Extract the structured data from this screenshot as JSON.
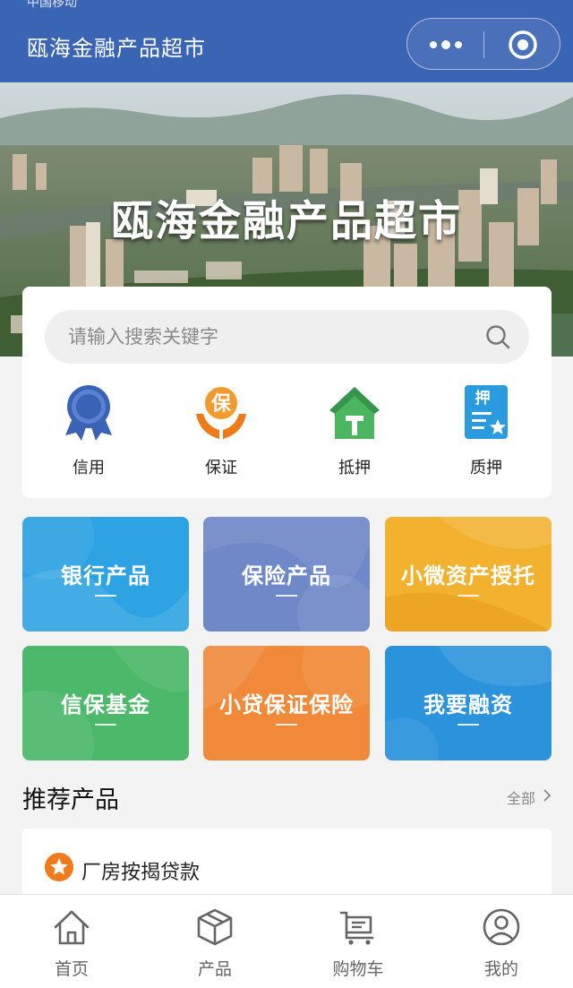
{
  "header": {
    "status_text": "中国移动",
    "title": "瓯海金融产品超市",
    "more_icon": "more-dots-icon",
    "target_icon": "target-icon"
  },
  "banner": {
    "title": "瓯海金融产品超市"
  },
  "search": {
    "placeholder": "请输入搜索关键字",
    "value": ""
  },
  "categories": [
    {
      "label": "信用",
      "icon": "ribbon-medal-icon",
      "color": "#3a62b5"
    },
    {
      "label": "保证",
      "icon": "hands-guarantee-icon",
      "color": "#f07a1c"
    },
    {
      "label": "抵押",
      "icon": "house-icon",
      "color": "#3fae5a"
    },
    {
      "label": "质押",
      "icon": "pledge-document-icon",
      "color": "#2b9be0"
    }
  ],
  "tiles": [
    {
      "label": "银行产品",
      "color": "#2ea3e3"
    },
    {
      "label": "保险产品",
      "color": "#6f88c8"
    },
    {
      "label": "小微资产授托",
      "color": "#f2b12e"
    },
    {
      "label": "信保基金",
      "color": "#4cb86a"
    },
    {
      "label": "小贷保证保险",
      "color": "#f08a3a"
    },
    {
      "label": "我要融资",
      "color": "#2b93dc"
    }
  ],
  "recommend": {
    "title": "推荐产品",
    "more_label": "全部",
    "items": [
      {
        "name": "厂房按揭贷款",
        "icon": "star-badge-icon"
      }
    ]
  },
  "tabbar": {
    "items": [
      {
        "label": "首页",
        "icon": "home-icon"
      },
      {
        "label": "产品",
        "icon": "cube-icon"
      },
      {
        "label": "购物车",
        "icon": "cart-icon"
      },
      {
        "label": "我的",
        "icon": "user-icon"
      }
    ]
  }
}
